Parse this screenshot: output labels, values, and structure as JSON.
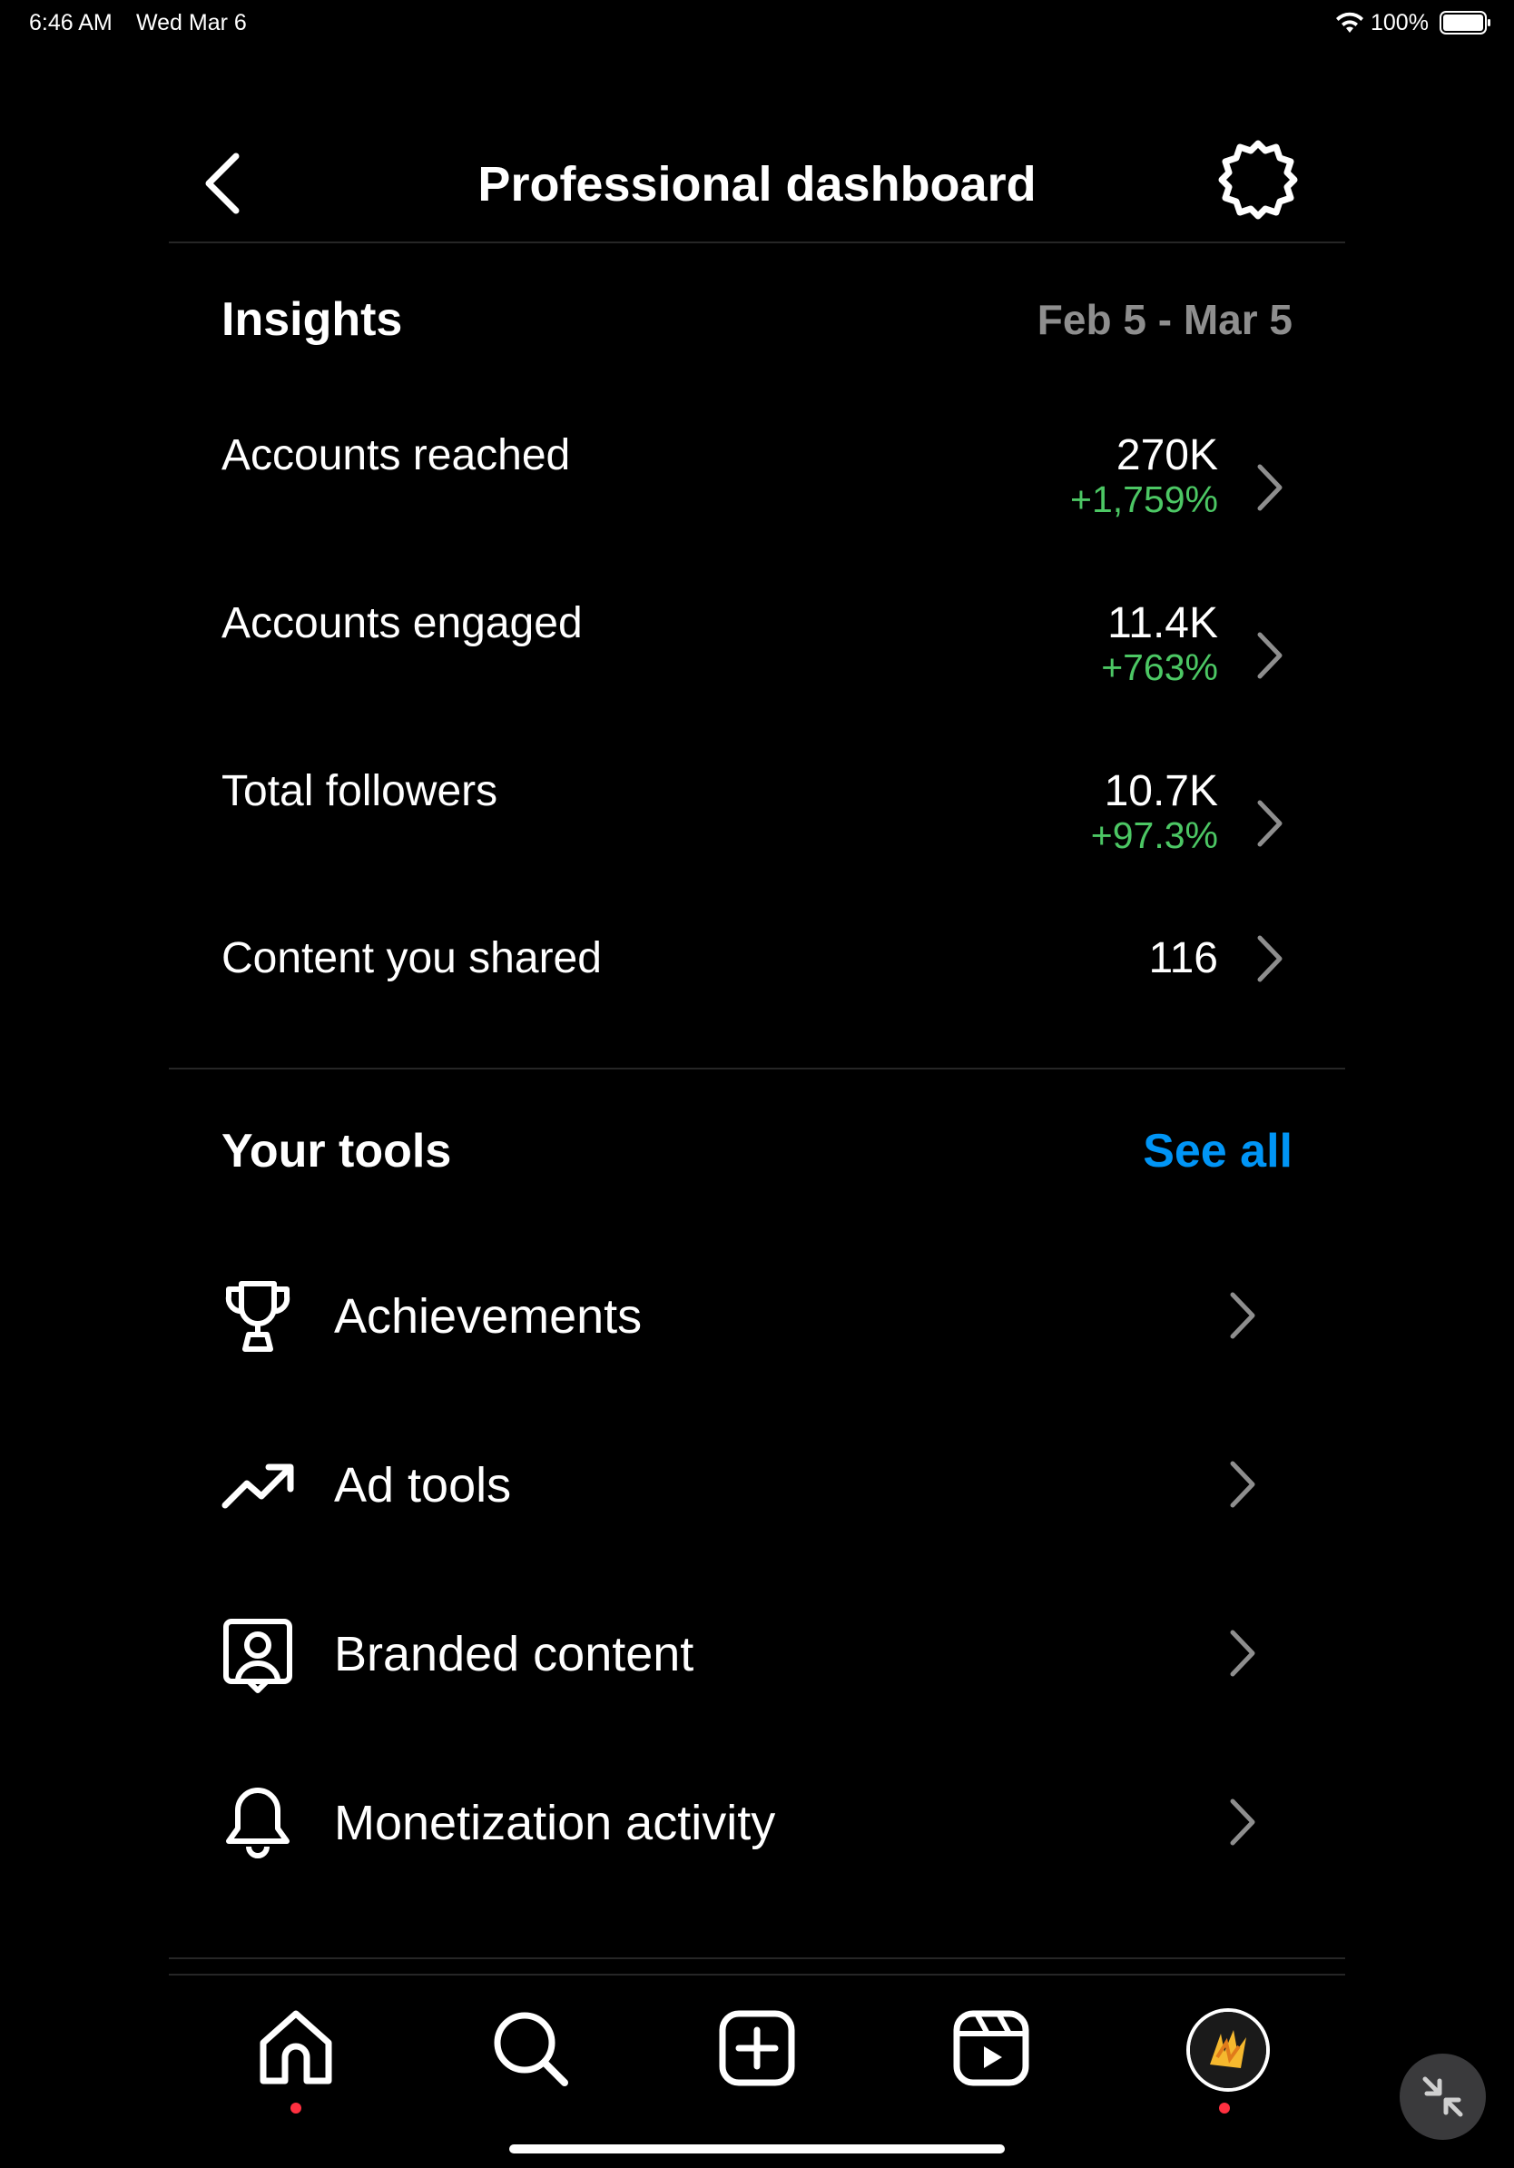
{
  "status_bar": {
    "time": "6:46 AM",
    "date": "Wed Mar 6",
    "battery_percent": "100%",
    "battery_level": 1.0
  },
  "header": {
    "title": "Professional dashboard",
    "back_icon": "chevron-left-icon",
    "settings_icon": "gear-icon"
  },
  "insights": {
    "title": "Insights",
    "date_range": "Feb 5 - Mar 5",
    "metrics": [
      {
        "label": "Accounts reached",
        "value": "270K",
        "change": "+1,759%"
      },
      {
        "label": "Accounts engaged",
        "value": "11.4K",
        "change": "+763%"
      },
      {
        "label": "Total followers",
        "value": "10.7K",
        "change": "+97.3%"
      },
      {
        "label": "Content you shared",
        "value": "116",
        "change": ""
      }
    ]
  },
  "tools": {
    "title": "Your tools",
    "see_all": "See all",
    "items": [
      {
        "label": "Achievements",
        "icon": "trophy-icon"
      },
      {
        "label": "Ad tools",
        "icon": "trending-up-icon"
      },
      {
        "label": "Branded content",
        "icon": "user-card-icon"
      },
      {
        "label": "Monetization activity",
        "icon": "bell-icon"
      }
    ]
  },
  "tab_bar": {
    "items": [
      "home-icon",
      "search-icon",
      "create-icon",
      "reels-icon",
      "profile-avatar"
    ],
    "notification_dots": [
      "home",
      "profile"
    ]
  },
  "colors": {
    "background": "#000000",
    "positive_change": "#4cc764",
    "link": "#0095f6",
    "muted": "#8e8e8e",
    "notification_dot": "#ff3040"
  }
}
